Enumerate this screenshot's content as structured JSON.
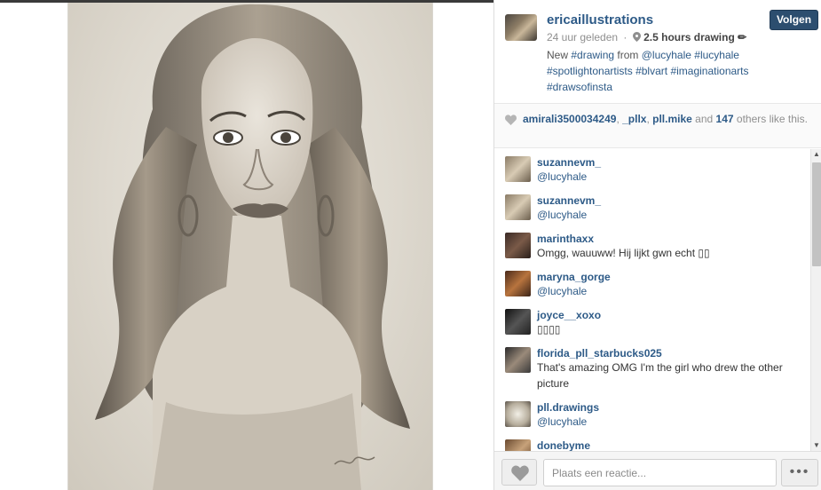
{
  "post": {
    "username": "ericaillustrations",
    "follow_label": "Volgen",
    "time_ago": "24 uur geleden",
    "location": "2.5 hours drawing ✏",
    "caption": {
      "prefix": "New ",
      "tag1": "#drawing",
      "mid1": " from ",
      "mention": "@lucyhale",
      "mid2": " ",
      "tag2": "#lucyhale",
      "tag3": "#spotlightonartists",
      "tag4": "#blvart",
      "tag5": "#imaginationarts",
      "tag6": "#drawsofinsta"
    }
  },
  "likes": {
    "user1": "amirali3500034249",
    "user2": "_pllx",
    "user3": "pll.mike",
    "and": " and ",
    "count": "147",
    "suffix": " others like this."
  },
  "comments": [
    {
      "user": "suzannevm_",
      "text": "@lucyhale"
    },
    {
      "user": "suzannevm_",
      "text": "@lucyhale"
    },
    {
      "user": "marinthaxx",
      "text": "Omgg, wauuww! Hij lijkt gwn echt ▯▯"
    },
    {
      "user": "maryna_gorge",
      "text": "@lucyhale"
    },
    {
      "user": "joyce__xoxo",
      "text": "▯▯▯▯"
    },
    {
      "user": "florida_pll_starbucks025",
      "text": "That's amazing OMG I'm the girl who drew the other picture"
    },
    {
      "user": "pll.drawings",
      "text": "@lucyhale"
    },
    {
      "user": "donebyme",
      "text": ""
    }
  ],
  "comment_bar": {
    "placeholder": "Plaats een reactie...",
    "more_label": "•••"
  },
  "scroll": {
    "up": "▲",
    "down": "▼"
  },
  "colors": {
    "link": "#2d5a87",
    "follow_button": "#2c4e6f"
  }
}
